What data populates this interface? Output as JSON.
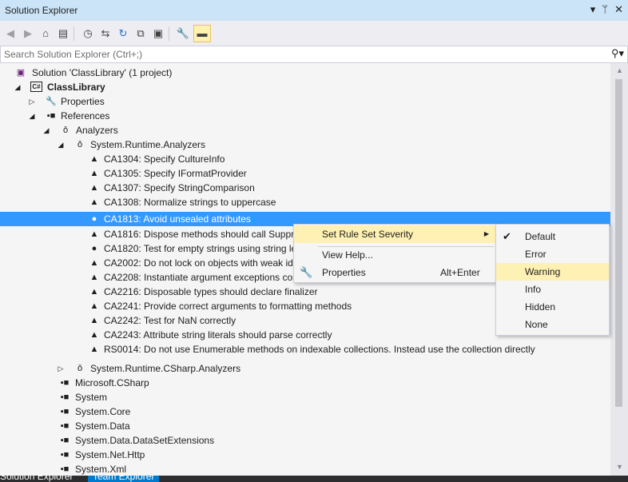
{
  "window": {
    "title": "Solution Explorer",
    "controls": [
      "▾",
      "ᛘ",
      "✕"
    ]
  },
  "toolbar": {
    "icons": [
      "back-icon",
      "forward-icon",
      "home-icon",
      "switch-views-icon",
      "history-icon",
      "sync-icon",
      "refresh-icon",
      "collapse-all-icon",
      "show-all-files-icon",
      "properties-icon",
      "preview-icon"
    ]
  },
  "search": {
    "placeholder": "Search Solution Explorer (Ctrl+;)"
  },
  "tree": {
    "rows": [
      {
        "label": "Solution 'ClassLibrary' (1 project)"
      },
      {
        "label": "ClassLibrary"
      },
      {
        "label": "Properties"
      },
      {
        "label": "References"
      },
      {
        "label": "Analyzers"
      },
      {
        "label": "System.Runtime.Analyzers"
      },
      {
        "label": "CA1304: Specify CultureInfo"
      },
      {
        "label": "CA1305: Specify IFormatProvider"
      },
      {
        "label": "CA1307: Specify StringComparison"
      },
      {
        "label": "CA1308: Normalize strings to uppercase"
      },
      {
        "label": "CA1813: Avoid unsealed attributes"
      },
      {
        "label": "CA1816: Dispose methods should call Suppre"
      },
      {
        "label": "CA1820: Test for empty strings using string le"
      },
      {
        "label": "CA2002: Do not lock on objects with weak id"
      },
      {
        "label": "CA2208: Instantiate argument exceptions correctly"
      },
      {
        "label": "CA2216: Disposable types should declare finalizer"
      },
      {
        "label": "CA2241: Provide correct arguments to formatting methods"
      },
      {
        "label": "CA2242: Test for NaN correctly"
      },
      {
        "label": "CA2243: Attribute string literals should parse correctly"
      },
      {
        "label": "RS0014: Do not use Enumerable methods on indexable collections. Instead use the collection directly"
      },
      {
        "label": "System.Runtime.CSharp.Analyzers"
      },
      {
        "label": "Microsoft.CSharp"
      },
      {
        "label": "System"
      },
      {
        "label": "System.Core"
      },
      {
        "label": "System.Data"
      },
      {
        "label": "System.Data.DataSetExtensions"
      },
      {
        "label": "System.Net.Http"
      },
      {
        "label": "System.Xml"
      }
    ]
  },
  "context_menu": {
    "items": [
      {
        "label": "Set Rule Set Severity",
        "shortcut": ""
      },
      {
        "label": "View Help...",
        "shortcut": ""
      },
      {
        "label": "Properties",
        "shortcut": "Alt+Enter"
      }
    ]
  },
  "severity_menu": {
    "items": [
      {
        "label": "Default",
        "checked": true
      },
      {
        "label": "Error"
      },
      {
        "label": "Warning"
      },
      {
        "label": "Info"
      },
      {
        "label": "Hidden"
      },
      {
        "label": "None"
      }
    ]
  },
  "bottom_tabs": [
    "Solution Explorer",
    "Team Explorer"
  ],
  "colors": {
    "selection": "#3399ff",
    "highlight": "#fff0b3",
    "titlebar": "#cce4f7"
  }
}
